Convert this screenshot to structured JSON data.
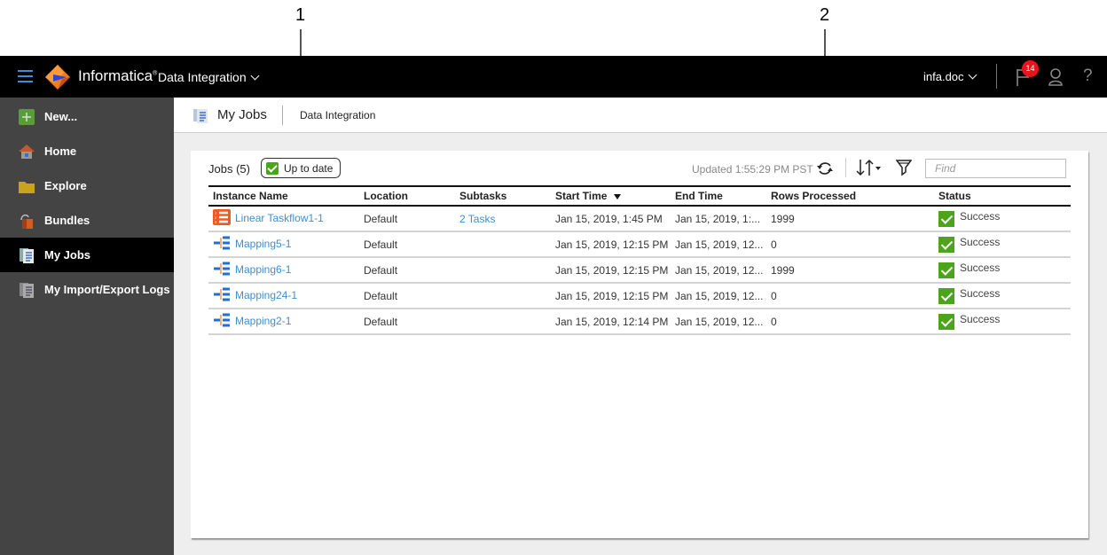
{
  "callouts": [
    "1",
    "2"
  ],
  "topbar": {
    "brand": "Informatica",
    "product": "Data Integration",
    "user": "infa.doc",
    "notification_count": "14",
    "help": "?"
  },
  "sidebar": {
    "items": [
      {
        "label": "New...",
        "icon": "plus-icon",
        "color": "#5a9c3a"
      },
      {
        "label": "Home",
        "icon": "home-icon",
        "color": "#c25a2e"
      },
      {
        "label": "Explore",
        "icon": "folder-icon",
        "color": "#c8a41e"
      },
      {
        "label": "Bundles",
        "icon": "bundle-icon",
        "color": "#d55b24"
      },
      {
        "label": "My Jobs",
        "icon": "jobs-icon",
        "active": true
      },
      {
        "label": "My Import/Export Logs",
        "icon": "logs-icon"
      }
    ]
  },
  "pagehead": {
    "title": "My Jobs",
    "breadcrumb": "Data Integration"
  },
  "toolbar": {
    "jobs_count": "Jobs (5)",
    "status_label": "Up to date",
    "updated": "Updated 1:55:29 PM PST",
    "find_placeholder": "Find"
  },
  "table": {
    "columns": [
      "Instance Name",
      "Location",
      "Subtasks",
      "Start Time",
      "End Time",
      "Rows Processed",
      "Status"
    ],
    "sorted_column": "Start Time",
    "rows": [
      {
        "name": "Linear Taskflow1-1",
        "type": "taskflow",
        "location": "Default",
        "subtasks": "2 Tasks",
        "start": "Jan 15, 2019, 1:45 PM",
        "end": "Jan 15, 2019, 1:...",
        "rows": "1999",
        "status": "Success"
      },
      {
        "name": "Mapping5-1",
        "type": "mapping",
        "location": "Default",
        "subtasks": "",
        "start": "Jan 15, 2019, 12:15 PM",
        "end": "Jan 15, 2019, 12...",
        "rows": "0",
        "status": "Success"
      },
      {
        "name": "Mapping6-1",
        "type": "mapping",
        "location": "Default",
        "subtasks": "",
        "start": "Jan 15, 2019, 12:15 PM",
        "end": "Jan 15, 2019, 12...",
        "rows": "1999",
        "status": "Success"
      },
      {
        "name": "Mapping24-1",
        "type": "mapping",
        "location": "Default",
        "subtasks": "",
        "start": "Jan 15, 2019, 12:15 PM",
        "end": "Jan 15, 2019, 12...",
        "rows": "0",
        "status": "Success"
      },
      {
        "name": "Mapping2-1",
        "type": "mapping",
        "location": "Default",
        "subtasks": "",
        "start": "Jan 15, 2019, 12:14 PM",
        "end": "Jan 15, 2019, 12...",
        "rows": "0",
        "status": "Success"
      }
    ]
  },
  "colors": {
    "accent_link": "#3d8fd1",
    "success": "#4aa41c",
    "badge": "#e8141c",
    "sidebar_bg": "#444444"
  }
}
